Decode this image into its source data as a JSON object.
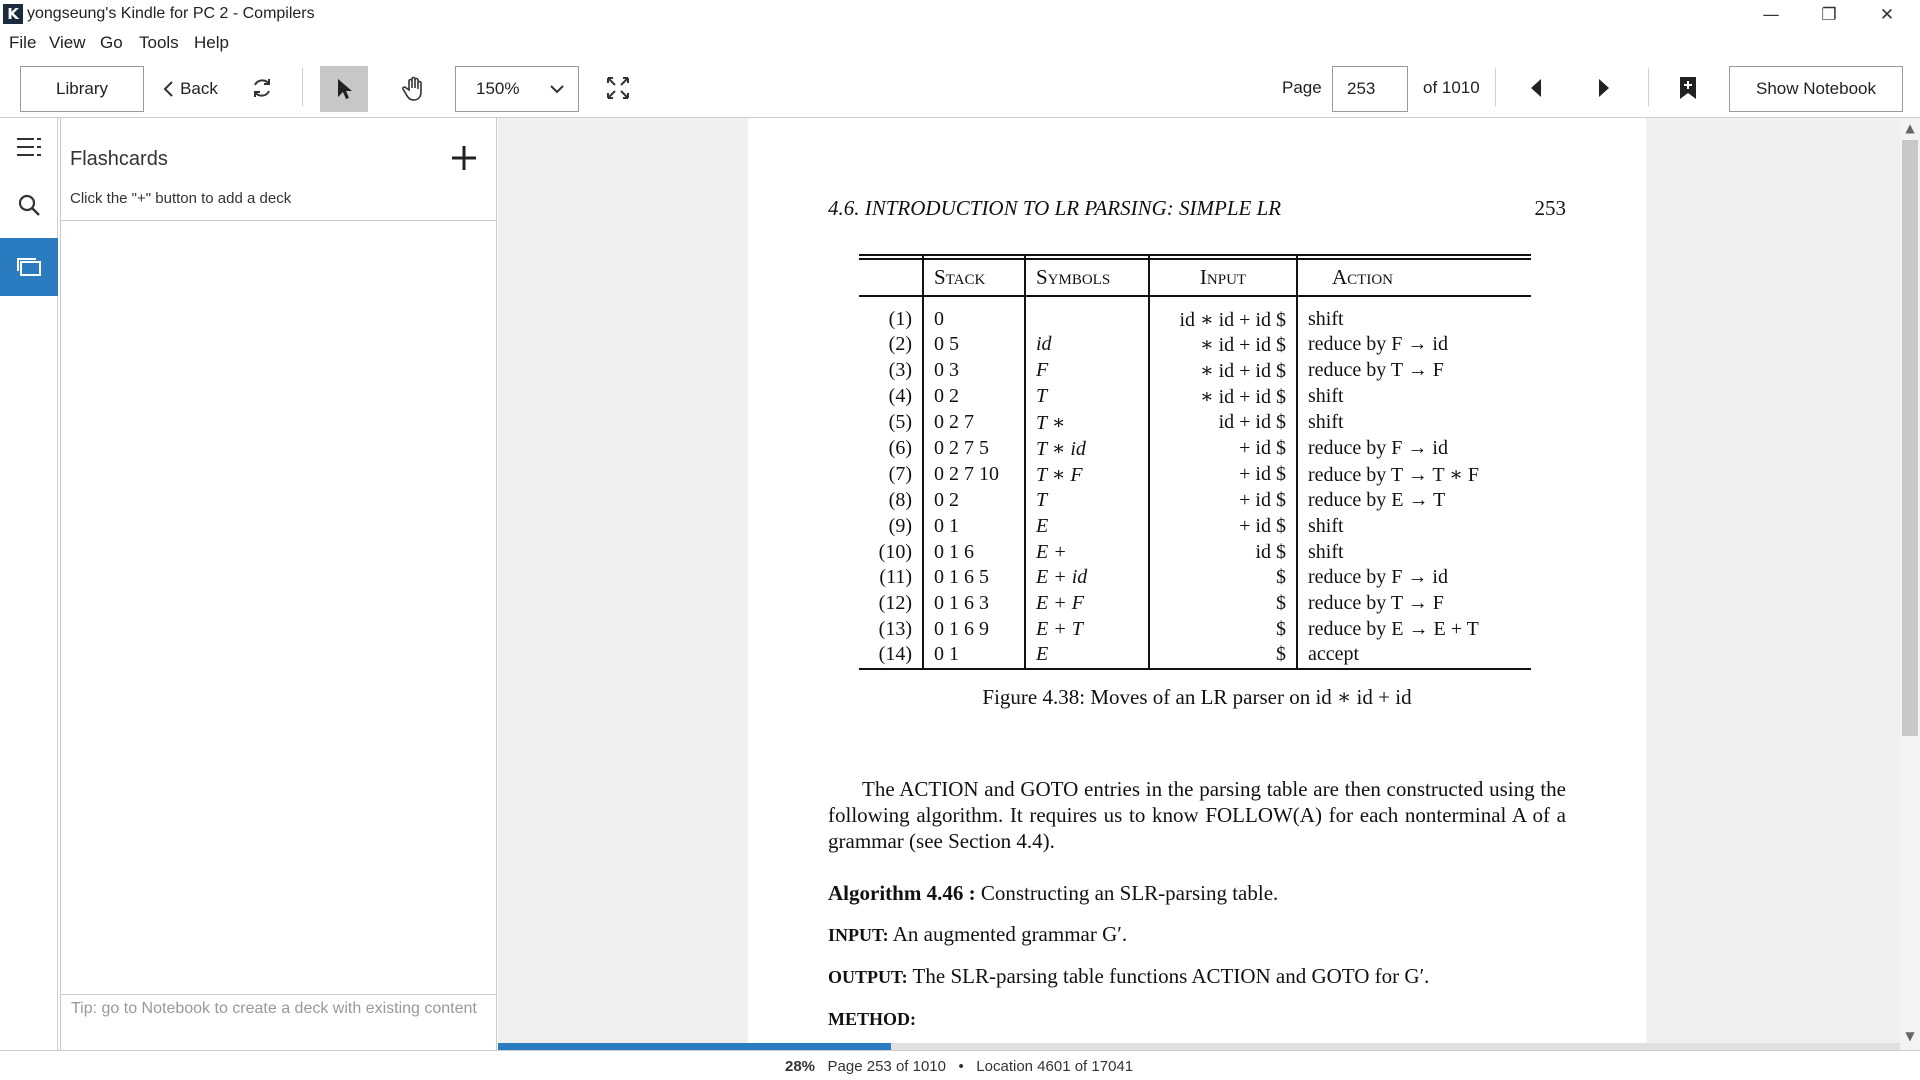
{
  "window": {
    "title": "yongseung's Kindle for PC 2 - Compilers",
    "app_icon_letter": "K",
    "minimize_glyph": "—",
    "maximize_glyph": "❐",
    "close_glyph": "✕"
  },
  "menu": [
    "File",
    "View",
    "Go",
    "Tools",
    "Help"
  ],
  "toolbar": {
    "library_label": "Library",
    "back_label": "Back",
    "zoom_value": "150%",
    "page_label": "Page",
    "page_value": "253",
    "page_total": "of 1010",
    "show_notebook_label": "Show Notebook",
    "icons": [
      "sync-icon",
      "select-pointer-icon",
      "hand-pan-icon",
      "zoom-dropdown-icon",
      "fullscreen-icon",
      "prev-page-icon",
      "next-page-icon",
      "bookmark-add-icon"
    ]
  },
  "rail": {
    "items": [
      "contents-icon",
      "search-icon",
      "flashcards-icon"
    ],
    "active": "flashcards-icon",
    "accent_color": "#2a7bc0"
  },
  "flashcards": {
    "title": "Flashcards",
    "hint": "Click the \"+\" button to add a deck",
    "tip": "Tip: go to Notebook to create a deck with existing content"
  },
  "book_page": {
    "running_head": "4.6.  INTRODUCTION TO LR PARSING: SIMPLE LR",
    "page_number": "253",
    "table_headers": [
      "Stack",
      "Symbols",
      "Input",
      "Action"
    ],
    "table_rows": [
      [
        "(1)",
        "0",
        "",
        "id ∗ id + id $",
        "shift"
      ],
      [
        "(2)",
        "0 5",
        "id",
        "∗ id + id $",
        "reduce by F → id"
      ],
      [
        "(3)",
        "0 3",
        "F",
        "∗ id + id $",
        "reduce by T → F"
      ],
      [
        "(4)",
        "0 2",
        "T",
        "∗ id + id $",
        "shift"
      ],
      [
        "(5)",
        "0 2 7",
        "T ∗",
        "id + id $",
        "shift"
      ],
      [
        "(6)",
        "0 2 7 5",
        "T ∗ id",
        "+ id $",
        "reduce by F → id"
      ],
      [
        "(7)",
        "0 2 7 10",
        "T ∗ F",
        "+ id $",
        "reduce by T → T ∗ F"
      ],
      [
        "(8)",
        "0 2",
        "T",
        "+ id $",
        "reduce by E → T"
      ],
      [
        "(9)",
        "0 1",
        "E",
        "+ id $",
        "shift"
      ],
      [
        "(10)",
        "0 1 6",
        "E +",
        "id $",
        "shift"
      ],
      [
        "(11)",
        "0 1 6 5",
        "E + id",
        "$",
        "reduce by F → id"
      ],
      [
        "(12)",
        "0 1 6 3",
        "E + F",
        "$",
        "reduce by T → F"
      ],
      [
        "(13)",
        "0 1 6 9",
        "E + T",
        "$",
        "reduce by E → E + T"
      ],
      [
        "(14)",
        "0 1",
        "E",
        "$",
        "accept"
      ]
    ],
    "caption": "Figure 4.38: Moves of an LR parser on id ∗ id + id",
    "paragraph": "The ACTION and GOTO entries in the parsing table are then constructed using the following algorithm. It requires us to know FOLLOW(A) for each nonterminal A of a grammar (see Section 4.4).",
    "algorithm_label": "Algorithm 4.46 :",
    "algorithm_title": "Constructing an SLR-parsing table.",
    "input_label": "INPUT:",
    "input_text": "An augmented grammar G′.",
    "output_label": "OUTPUT:",
    "output_text": "The SLR-parsing table functions ACTION and GOTO for G′.",
    "method_label": "METHOD:"
  },
  "reading_progress": 0.28,
  "status": {
    "percent": "28%",
    "page": "Page 253 of 1010",
    "separator": "•",
    "location": "Location 4601 of 17041"
  }
}
